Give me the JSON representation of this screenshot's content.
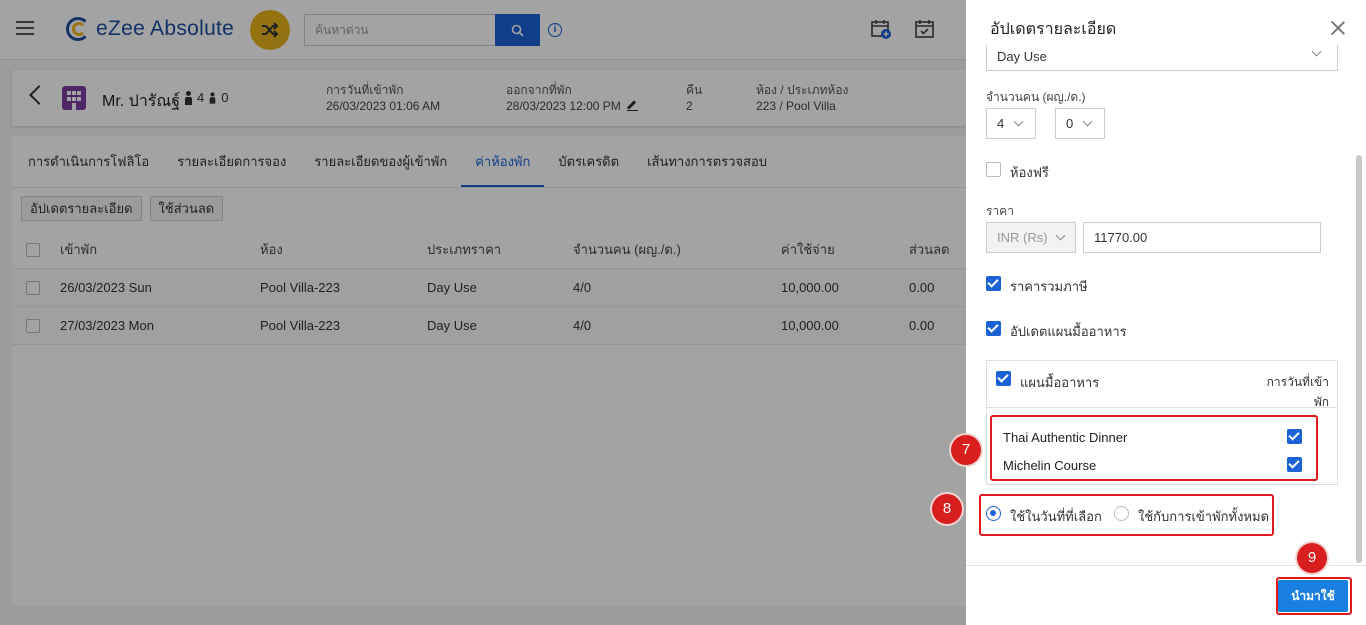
{
  "app": {
    "brand": "eZee Absolute",
    "search_placeholder": "ค้นหาด่วน",
    "info_symbol": "i"
  },
  "guest": {
    "name": "Mr. ปารัณฐ์",
    "adults": "4",
    "children": "0",
    "checkin_label": "การวันที่เข้าพัก",
    "checkin_value": "26/03/2023 01:06 AM",
    "checkout_label": "ออกจากที่พัก",
    "checkout_value": "28/03/2023 12:00 PM",
    "nights_label": "คืน",
    "nights_value": "2",
    "room_label": "ห้อง / ประเภทห้อง",
    "room_value": "223 / Pool Villa"
  },
  "tabs": [
    {
      "label": "การดำเนินการโฟลิโอ"
    },
    {
      "label": "รายละเอียดการจอง"
    },
    {
      "label": "รายละเอียดของผู้เข้าพัก"
    },
    {
      "label": "ค่าห้องพัก"
    },
    {
      "label": "บัตรเครดิต"
    },
    {
      "label": "เส้นทางการตรวจสอบ"
    }
  ],
  "actions": {
    "update_details": "อัปเดตรายละเอียด",
    "apply_discount": "ใช้ส่วนลด"
  },
  "table": {
    "headers": [
      "เข้าพัก",
      "ห้อง",
      "ประเภทราคา",
      "จำนวนคน (ผญ./ด.)",
      "ค่าใช้จ่าย",
      "ส่วนลด"
    ],
    "rows": [
      [
        "26/03/2023 Sun",
        "Pool Villa-223",
        "Day Use",
        "4/0",
        "10,000.00",
        "0.00"
      ],
      [
        "27/03/2023 Mon",
        "Pool Villa-223",
        "Day Use",
        "4/0",
        "10,000.00",
        "0.00"
      ]
    ]
  },
  "panel": {
    "title": "อัปเดตรายละเอียด",
    "rate_type": "Day Use",
    "pax_label": "จำนวนคน (ผญ./ด.)",
    "adults": "4",
    "children": "0",
    "free_room_label": "ห้องฟรี",
    "price_label": "ราคา",
    "currency": "INR (Rs)",
    "price_value": "11770.00",
    "tax_inclusive_label": "ราคารวมภาษี",
    "update_meal_label": "อัปเดตแผนมื้ออาหาร",
    "meal_header": "แผนมื้ออาหาร",
    "meal_col_header_line1": "การวันที่เข้า",
    "meal_col_header_line2": "พัก",
    "meals": [
      "Thai Authentic Dinner",
      "Michelin Course"
    ],
    "radio_selected_dates": "ใช้ในวันที่ที่เลือก",
    "radio_all_stay": "ใช้กับการเข้าพักทั้งหมด",
    "apply_button": "นำมาใช้"
  },
  "annotations": {
    "step7": "7",
    "step8": "8",
    "step9": "9"
  },
  "colors": {
    "primary": "#1a62d6",
    "annotation_red": "#e0191e",
    "brand_yellow": "#e8b31c"
  }
}
